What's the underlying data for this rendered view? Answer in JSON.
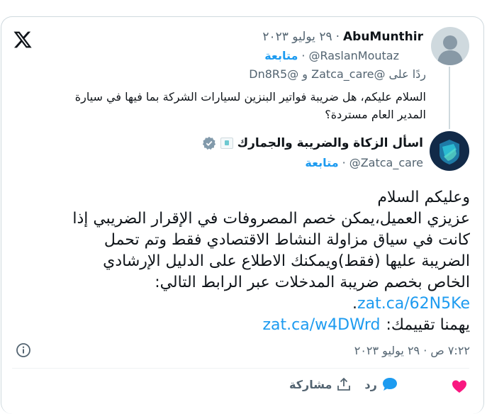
{
  "parent_tweet": {
    "display_name": "AbuMunthir",
    "date": "٢٩ يوليو ٢٠٢٣",
    "handle": "@RaslanMoutaz",
    "follow_label": "متابعة",
    "replying_to_prefix": "ردًا على",
    "replying_to_handles": "@Zatca_care و @Dn8R5",
    "text_lines": [
      "السلام عليكم، هل ضريبة فواتير البنزين لسيارات الشركة بما فيها في سيارة",
      "المدير العام مستردة؟"
    ]
  },
  "reply_tweet": {
    "display_name": "اسأل الزكاة والضريبة والجمارك",
    "handle": "@Zatca_care",
    "follow_label": "متابعة",
    "body_lines": [
      "وعليكم السلام",
      "عزيزي العميل،يمكن خصم المصروفات في الإقرار الضريبي إذا",
      "كانت في سياق مزاولة النشاط الاقتصادي فقط وتم تحمل",
      "الضريبة عليها (فقط)ويمكنك الاطلاع على الدليل الإرشادي",
      "الخاص بخصم ضريبة المدخلات عبر الرابط التالي:"
    ],
    "link1": "zat.ca/62N5Ke",
    "link1_suffix": ".",
    "rating_prefix": "يهمنا تقييمك:",
    "link2": "zat.ca/w4DWrd",
    "timestamp": "٧:٢٢ ص · ٢٩ يوليو ٢٠٢٣"
  },
  "actions": {
    "reply_label": "رد",
    "share_label": "مشاركة"
  },
  "colors": {
    "accent": "#1d9bf0",
    "like": "#f91880",
    "muted": "#536471",
    "border": "#cfd9de"
  },
  "icons": {
    "logo": "x-logo-icon",
    "verified": "verified-badge-icon",
    "info": "info-icon",
    "like": "heart-icon",
    "reply": "speech-bubble-icon",
    "share": "share-icon"
  }
}
